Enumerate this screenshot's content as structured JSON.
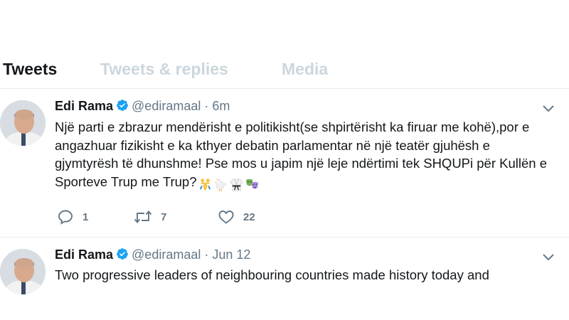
{
  "tabs": [
    {
      "label": "Tweets",
      "active": true
    },
    {
      "label": "Tweets & replies",
      "active": false
    },
    {
      "label": "Media",
      "active": false
    }
  ],
  "tweets": [
    {
      "name": "Edi Rama",
      "handle": "@ediramaal",
      "separator": "·",
      "time": "6m",
      "text": "Një parti e zbrazur mendërisht e politikisht(se shpirtërisht ka firuar me kohë),por e angazhuar fizikisht e ka kthyer debatin parlamentar në një teatër gjuhësh e gjymtyrësh të dhunshme! Pse mos u japim një leje ndërtimi tek SHQUPi për Kullën e Sporteve Trup me Trup?",
      "emojis": [
        "wrestlers-emoji",
        "rooster-emoji",
        "martial-arts-uniform-emoji",
        "performing-arts-emoji"
      ],
      "replies": "1",
      "retweets": "7",
      "likes": "22"
    },
    {
      "name": "Edi Rama",
      "handle": "@ediramaal",
      "separator": "·",
      "time": "Jun 12",
      "text": "Two progressive leaders of neighbouring countries made history today and"
    }
  ],
  "colors": {
    "primary_text": "#14171a",
    "secondary_text": "#657786",
    "inactive_tab": "#ccd6dd",
    "verified_blue": "#1da1f2",
    "divider": "#e6ecf0"
  },
  "icons": [
    "verified-icon",
    "chevron-down-icon",
    "reply-icon",
    "retweet-icon",
    "like-icon"
  ]
}
